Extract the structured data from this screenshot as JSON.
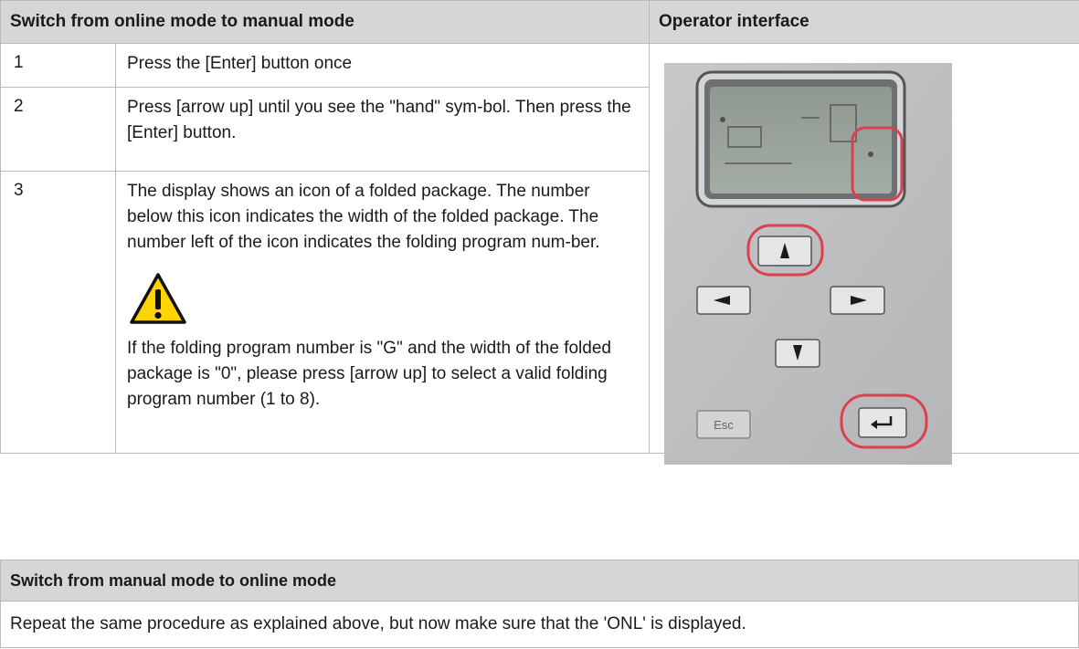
{
  "section1": {
    "col_left_header": "Switch from online mode to manual mode",
    "col_right_header": "Operator interface",
    "steps": [
      {
        "num": "1",
        "text": "Press the [Enter] button once"
      },
      {
        "num": "2",
        "text": "Press [arrow up] until you see the \"hand\" sym-bol. Then press the [Enter] button."
      },
      {
        "num": "3",
        "text": "The display shows an icon of a folded package. The number below this icon indicates the width of the folded package. The number left of the icon indicates the folding program num-ber.",
        "warning": "If the folding program number is \"G\" and the width of the folded package is \"0\", please press [arrow up] to select a valid folding program number (1 to 8)."
      }
    ]
  },
  "panel": {
    "esc_label": "Esc",
    "highlight_color": "#d9414e"
  },
  "section2": {
    "header": "Switch from manual mode to online mode",
    "text": "Repeat the same procedure as explained above, but now make sure that the 'ONL' is displayed."
  }
}
